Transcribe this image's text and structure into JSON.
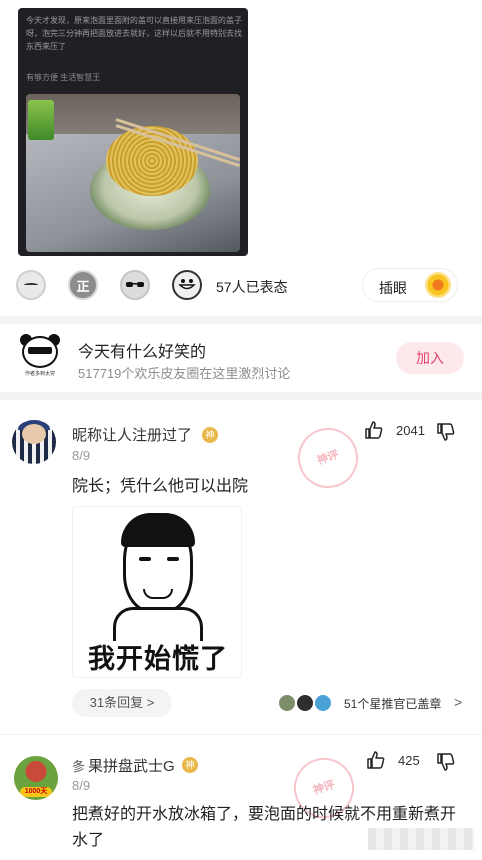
{
  "post": {
    "text": "今天才发现，原来泡面里面附的盖可以直接用来压泡面的盖子呀，泡完三分钟再把面放进去就好，这样以后就不用特别去找东西来压了",
    "signature": "有够方便 生活智慧王"
  },
  "reactions": {
    "count_text": "57人已表态",
    "pick_label": "插眼",
    "emoji_zheng": "正"
  },
  "circle": {
    "title": "今天有什么好笑的",
    "subtitle": "517719个欢乐皮友圈在这里激烈讨论",
    "join_label": "加入",
    "avatar_caption": "作者多到太穷"
  },
  "comments": [
    {
      "name": "昵称让人注册过了",
      "badge": "神",
      "date": "8/9",
      "text": "院长；凭什么他可以出院",
      "likes": "2041",
      "meme_caption": "我开始慌了",
      "reply_label": "31条回复 >",
      "stamp_text": "51个星推官已盖章",
      "stamp_chevron": ">",
      "stamp_mark": "神评"
    },
    {
      "prefix": "㣊",
      "name": "果拼盘武士G",
      "badge": "神",
      "date": "8/9",
      "text": "把煮好的开水放冰箱了，要泡面的时候就不用重新煮开水了",
      "likes": "425",
      "avatar_tag": "1000天",
      "stamp_mark": "神评"
    }
  ]
}
